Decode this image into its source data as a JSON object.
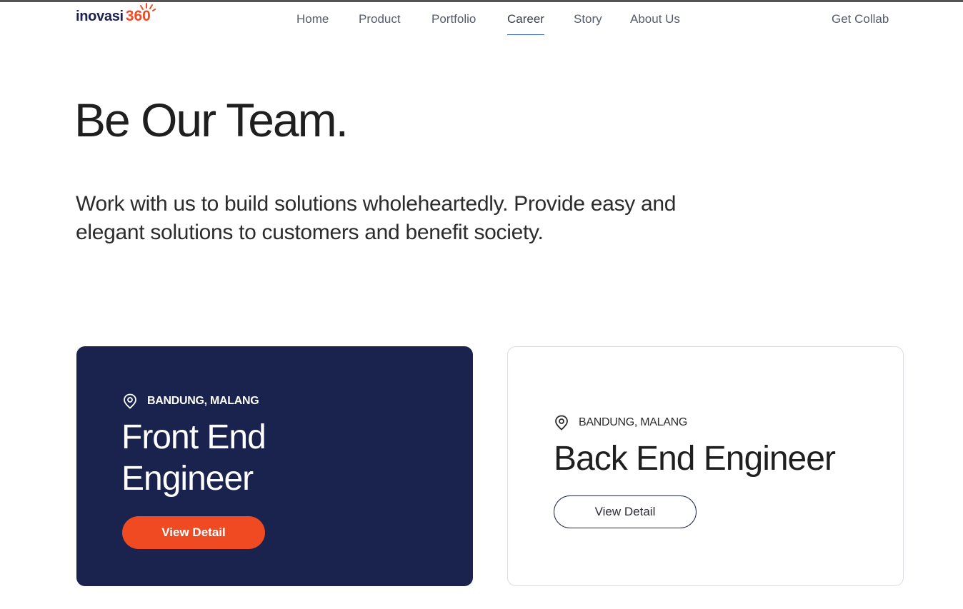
{
  "brand": {
    "logo_word": "inovasi",
    "logo_number": "360",
    "accent_color": "#ef4b24",
    "navy_color": "#1b2250"
  },
  "nav": {
    "items": [
      {
        "label": "Home"
      },
      {
        "label": "Product"
      },
      {
        "label": "Portfolio"
      },
      {
        "label": "Career",
        "active": true
      },
      {
        "label": "Story"
      },
      {
        "label": "About Us"
      }
    ],
    "cta_label": "Get Collab"
  },
  "hero": {
    "title": "Be Our Team.",
    "description": "Work with us to build solutions wholeheartedly. Provide easy and elegant solutions to customers and benefit society."
  },
  "jobs": [
    {
      "location": "BANDUNG, MALANG",
      "title_line1": "Front End",
      "title_line2": "Engineer",
      "button_label": "View Detail",
      "icon": "location-pin-icon"
    },
    {
      "location": "BANDUNG, MALANG",
      "title": "Back End Engineer",
      "button_label": "View Detail",
      "icon": "location-pin-icon"
    }
  ],
  "colors": {
    "card_dark": "#19234d",
    "button_orange": "#f04a23",
    "active_underline": "#3b6fd4"
  }
}
